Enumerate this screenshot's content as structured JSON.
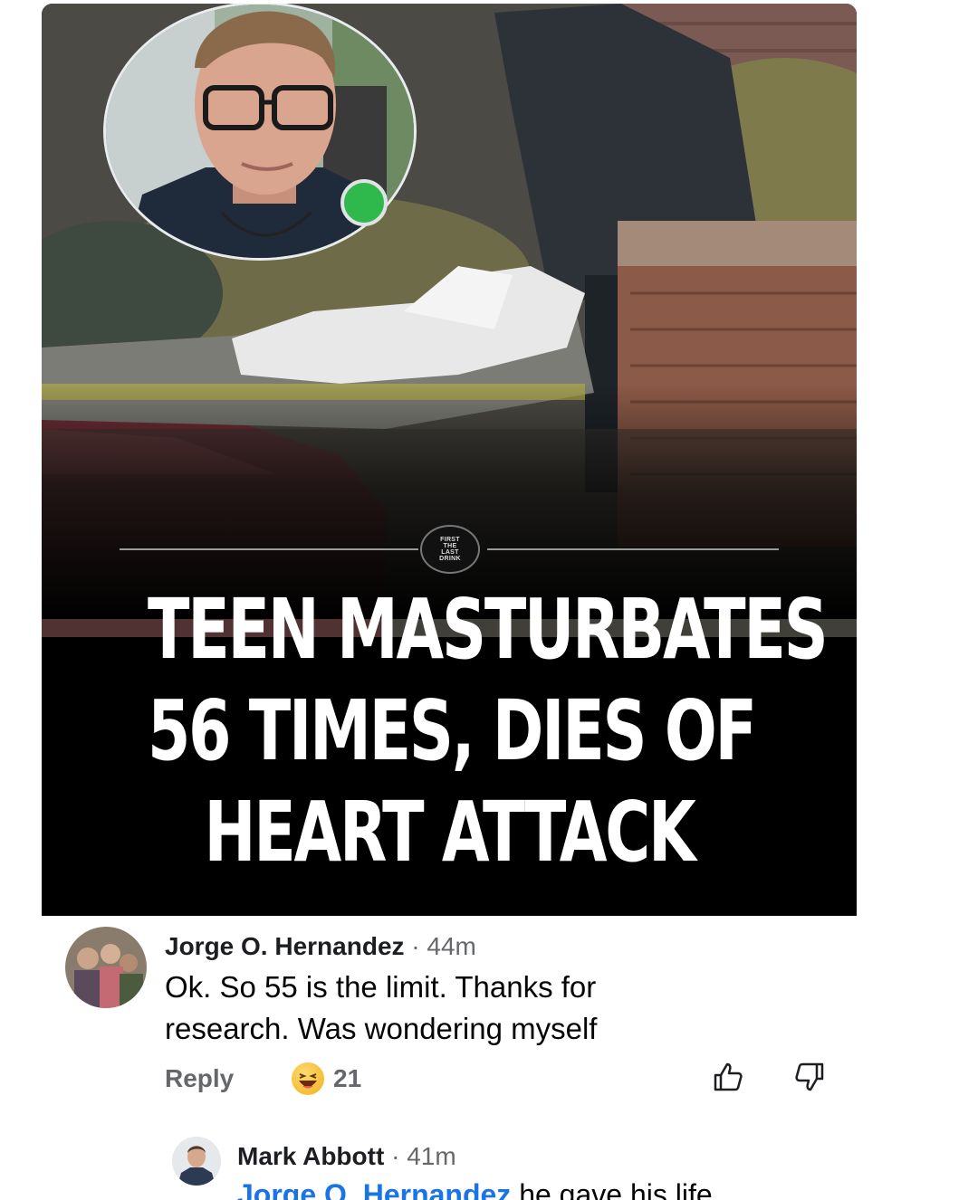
{
  "post": {
    "headline_lines": [
      "TEEN MASTURBATES",
      "56 TIMES, DIES OF",
      "HEART ATTACK"
    ],
    "brand_logo_text": [
      "FIRST",
      "THE",
      "LAST",
      "DRINK"
    ],
    "inset_icon": "profile-photo",
    "online_indicator_color": "#2fb84b"
  },
  "comments": [
    {
      "author": "Jorge O. Hernandez",
      "separator": "·",
      "time": "44m",
      "text_lines": [
        "Ok. So 55 is the limit.  Thanks for",
        "research.  Was wondering myself"
      ],
      "reply_label": "Reply",
      "reaction_icon": "laughing-emoji-icon",
      "reaction_count": "21",
      "like_icon": "thumbs-up-icon",
      "dislike_icon": "thumbs-down-icon"
    }
  ],
  "replies": [
    {
      "author": "Mark Abbott",
      "separator": "·",
      "time": "41m",
      "mention": "Jorge O. Hernandez",
      "text": "he gave his life"
    }
  ],
  "colors": {
    "author_text": "#1c1e21",
    "secondary_text": "#65676b",
    "mention_link": "#1b74e4",
    "headline_text": "#ffffff",
    "headline_bg": "#000000"
  }
}
